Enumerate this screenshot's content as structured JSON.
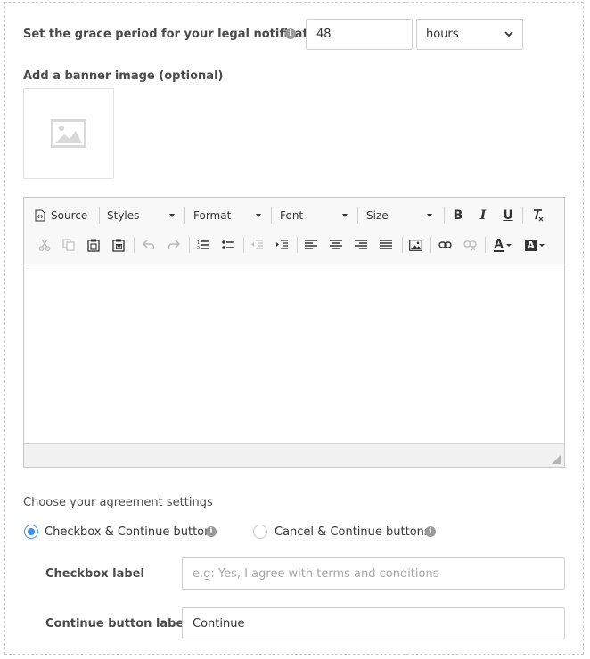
{
  "grace": {
    "label": "Set the grace period for your legal notification",
    "value": "48",
    "unit_selected": "hours",
    "info_icon": "info-icon"
  },
  "banner": {
    "label": "Add a banner image (optional)",
    "icon": "image-placeholder-icon"
  },
  "editor": {
    "source_label": "Source",
    "styles_label": "Styles",
    "format_label": "Format",
    "font_label": "Font",
    "size_label": "Size",
    "bold_label": "B",
    "italic_label": "I",
    "underline_label": "U",
    "text_color_label": "A",
    "bg_color_label": "A",
    "content": ""
  },
  "agreement": {
    "heading": "Choose your agreement settings",
    "options": [
      {
        "label": "Checkbox & Continue button",
        "checked": true
      },
      {
        "label": "Cancel & Continue buttons",
        "checked": false
      }
    ],
    "checkbox_label": {
      "label": "Checkbox label",
      "value": "",
      "placeholder": "e.g: Yes, I agree with terms and conditions"
    },
    "continue_label": {
      "label": "Continue button label",
      "value": "Continue"
    }
  },
  "colors": {
    "accent": "#3d8eea",
    "border": "#d0d0d0",
    "toolbar_bg": "#f8f8f8"
  }
}
